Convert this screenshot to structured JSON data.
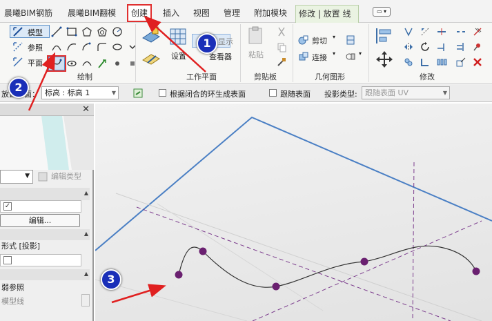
{
  "tabs": [
    {
      "label": "晨曦BIM钢筋"
    },
    {
      "label": "晨曦BIM翻模"
    },
    {
      "label": "创建"
    },
    {
      "label": "插入"
    },
    {
      "label": "视图"
    },
    {
      "label": "管理"
    },
    {
      "label": "附加模块"
    },
    {
      "label": "修改 | 放置 线"
    }
  ],
  "ribbon": {
    "draw": {
      "model_label": "模型",
      "reference_label": "参照",
      "plane_label": "平面",
      "group_label": "绘制"
    },
    "workplane": {
      "set_label": "设置",
      "show_label": "显示",
      "viewer_label": "查看器",
      "group_label": "工作平面"
    },
    "clipboard": {
      "paste_label": "粘贴",
      "group_label": "剪贴板"
    },
    "geometry": {
      "cut_label": "剪切",
      "join_label": "连接",
      "group_label": "几何图形"
    },
    "modify": {
      "group_label": "修改"
    }
  },
  "options_bar": {
    "placement_label": "放置平面：",
    "placement_value": "标高 : 标高 1",
    "closed_loop_label": "根据闭合的环生成表面",
    "follow_surface_label": "跟随表面",
    "projection_label": "投影类型:",
    "projection_value": "跟随表面 UV"
  },
  "properties": {
    "edit_type_label": "编辑类型",
    "edit_button_label": "编辑...",
    "form_row_label": "形式 [投影]",
    "weak_ref_label": "弱参照",
    "model_line_label": "模型线"
  },
  "callouts": [
    "1",
    "2",
    "3"
  ],
  "colors": {
    "highlight_red": "#e03030",
    "callout_blue": "#1a2fb8",
    "plane_edge_blue": "#4a7fc4",
    "ref_line_purple": "#7a3a8c",
    "spline_point": "#6a2070"
  }
}
